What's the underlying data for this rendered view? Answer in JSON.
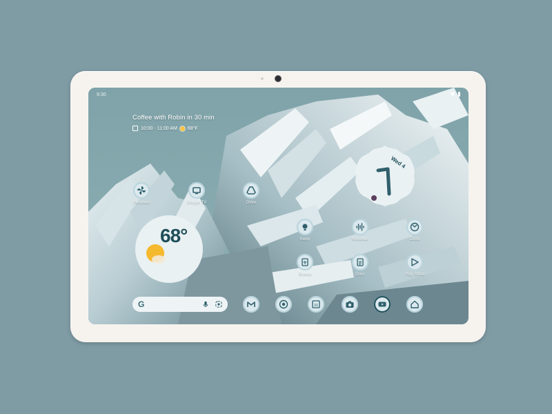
{
  "status_bar": {
    "time": "9:30"
  },
  "at_a_glance": {
    "title": "Coffee with Robin in 30 min",
    "time_range": "10:00 - 11:00 AM",
    "temperature": "68°F"
  },
  "home_apps": [
    {
      "label": "Pinwheel",
      "icon": "pinwheel-icon"
    },
    {
      "label": "Google TV",
      "icon": "google-tv-icon"
    },
    {
      "label": "Drive",
      "icon": "drive-icon"
    },
    {
      "label": "Keep",
      "icon": "keep-icon"
    },
    {
      "label": "Recorder",
      "icon": "recorder-icon"
    },
    {
      "label": "Clock",
      "icon": "clock-icon"
    },
    {
      "label": "Sheets",
      "icon": "sheets-icon"
    },
    {
      "label": "Docs",
      "icon": "docs-icon"
    },
    {
      "label": "Play Store",
      "icon": "play-store-icon"
    }
  ],
  "weather_widget": {
    "temperature": "68°"
  },
  "clock_widget": {
    "date": "Wed 4"
  },
  "dock": [
    {
      "name": "gmail-icon"
    },
    {
      "name": "chrome-icon"
    },
    {
      "name": "calendar-icon",
      "text": "31"
    },
    {
      "name": "camera-icon"
    },
    {
      "name": "youtube-icon"
    },
    {
      "name": "home-icon"
    }
  ],
  "search": {
    "logo": "G"
  },
  "colors": {
    "background": "#7f9ba4",
    "tablet_frame": "#f6f3ef",
    "icon_fill": "#dbe9ee",
    "accent_dark": "#1f4e5a"
  }
}
